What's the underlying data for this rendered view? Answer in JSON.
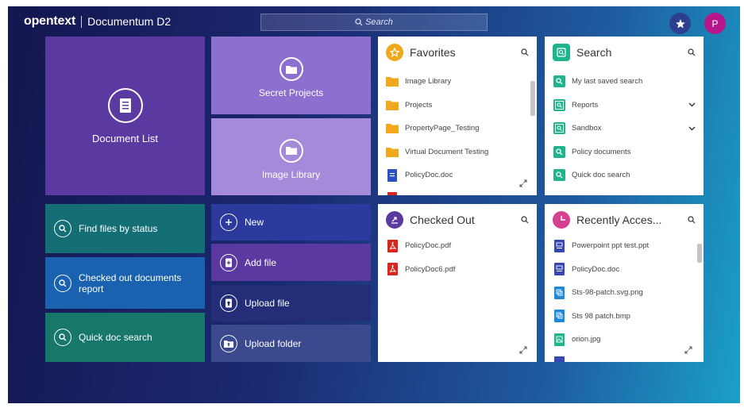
{
  "header": {
    "brand_logo": "opentext",
    "product_name": "Documentum D2",
    "search_placeholder": "Search",
    "avatar_initial": "P"
  },
  "tiles": {
    "document_list": "Document List",
    "secret_projects": "Secret Projects",
    "image_library": "Image Library",
    "find_files": "Find files by status",
    "checked_out_report": "Checked out documents report",
    "quick_doc_search": "Quick doc search",
    "new": "New",
    "add_file": "Add file",
    "upload_file": "Upload file",
    "upload_folder": "Upload folder"
  },
  "favorites": {
    "title": "Favorites",
    "items": [
      "Image Library",
      "Projects",
      "PropertyPage_Testing",
      "Virtual Document Testing",
      "PolicyDoc.doc"
    ]
  },
  "search_panel": {
    "title": "Search",
    "items": [
      "My last saved search",
      "Reports",
      "Sandbox",
      "Policy documents",
      "Quick doc search"
    ]
  },
  "checked_out": {
    "title": "Checked Out",
    "items": [
      "PolicyDoc.pdf",
      "PolicyDoc6.pdf"
    ]
  },
  "recently_accessed": {
    "title": "Recently Acces...",
    "items": [
      "Powerpoint ppt test.ppt",
      "PolicyDoc.doc",
      "Sts-98-patch.svg.png",
      "Sts 98 patch.bmp",
      "orion.jpg"
    ]
  },
  "colors": {
    "tile_purple_dark": "#5a3aa0",
    "tile_purple_light": "#9b7fd6",
    "tile_teal": "#146e75",
    "tile_blue": "#1a62b0",
    "tile_indigo": "#2b3a9c",
    "favorites_accent": "#f0a81c",
    "search_accent": "#1fb48c",
    "checked_out_accent": "#5b3aa0",
    "recent_accent": "#d6418f"
  }
}
